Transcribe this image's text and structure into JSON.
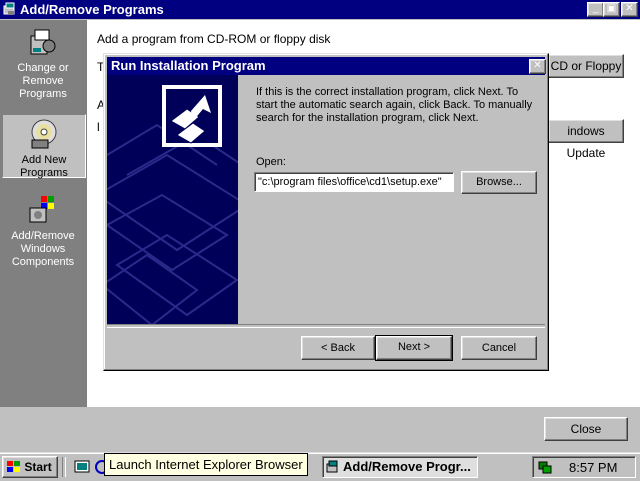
{
  "window": {
    "title": "Add/Remove Programs",
    "controls": {
      "minimize": "_",
      "maximize": "▣",
      "close": "✕"
    }
  },
  "sidebar": {
    "items": [
      {
        "label": "Change or\nRemove\nPrograms",
        "icon": "change-remove-programs-icon"
      },
      {
        "label": "Add New\nPrograms",
        "icon": "cd-disk-icon",
        "selected": true
      },
      {
        "label": "Add/Remove\nWindows\nComponents",
        "icon": "windows-components-icon"
      }
    ]
  },
  "content": {
    "cd_heading": "Add a program from CD-ROM or floppy disk",
    "cd_button": "CD or Floppy",
    "windows_update_button": "indows Update"
  },
  "dialog": {
    "title": "Run Installation Program",
    "close": "✕",
    "instructions": "If this is the correct installation program, click Next. To start the automatic search again, click Back. To manually search for the installation program, click Next.",
    "open_label": "Open:",
    "open_value": "\"c:\\program files\\office\\cd1\\setup.exe\"",
    "browse_button": "Browse...",
    "back_button": "< Back",
    "next_button": "Next >",
    "cancel_button": "Cancel"
  },
  "close_button": "Close",
  "taskbar": {
    "start": "Start",
    "tooltip": "Launch Internet Explorer Browser",
    "task": "Add/Remove Progr...",
    "clock": "8:57 PM"
  },
  "colors": {
    "title_bar": "#000080",
    "face": "#c0c0c0",
    "sidebar": "#808080",
    "banner": "#000058"
  }
}
